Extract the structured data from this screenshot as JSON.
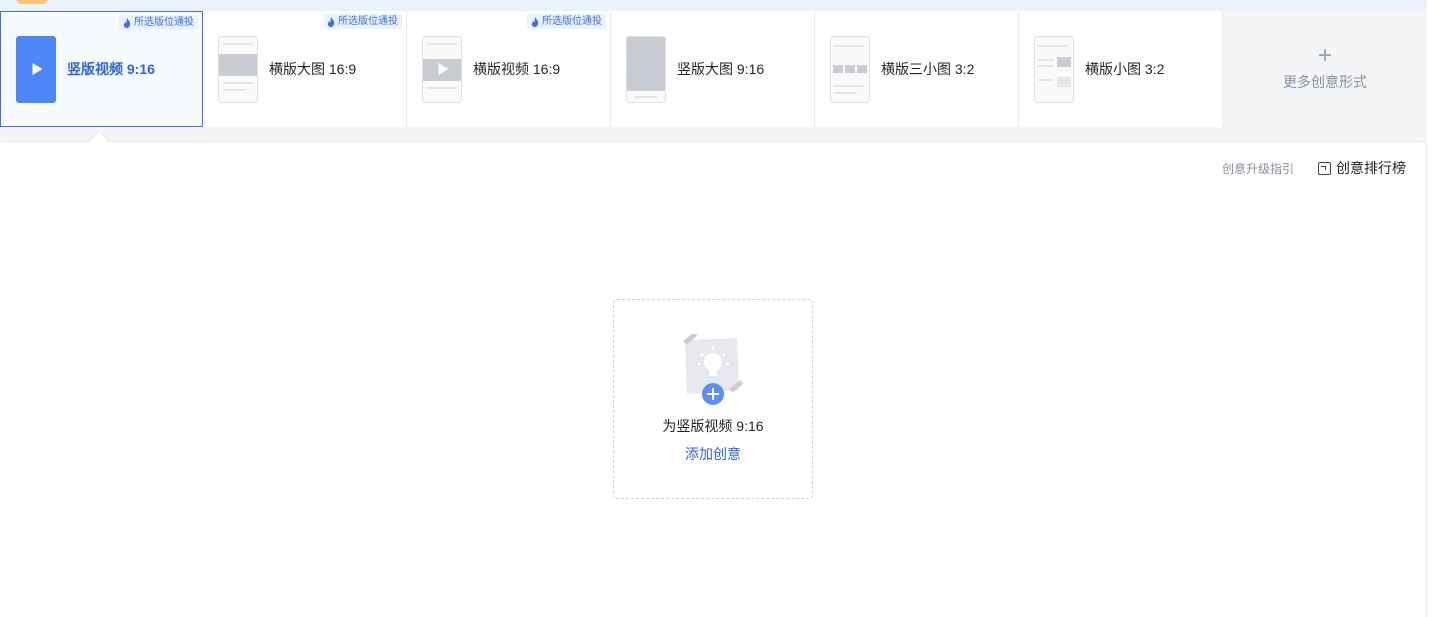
{
  "tabs": [
    {
      "label": "竖版视频 9:16",
      "badge": "所选版位通投",
      "active": true,
      "thumb": "vertical-video"
    },
    {
      "label": "横版大图 16:9",
      "badge": "所选版位通投",
      "active": false,
      "thumb": "horizontal-image"
    },
    {
      "label": "横版视频 16:9",
      "badge": "所选版位通投",
      "active": false,
      "thumb": "horizontal-video"
    },
    {
      "label": "竖版大图 9:16",
      "badge": "",
      "active": false,
      "thumb": "vertical-image"
    },
    {
      "label": "横版三小图 3:2",
      "badge": "",
      "active": false,
      "thumb": "three-small-images"
    },
    {
      "label": "横版小图 3:2",
      "badge": "",
      "active": false,
      "thumb": "small-image"
    }
  ],
  "more": {
    "icon": "plus-icon",
    "label": "更多创意形式"
  },
  "panel": {
    "guide_link": "创意升级指引",
    "rank_link": "创意排行榜",
    "add_card": {
      "title": "为竖版视频 9:16",
      "action": "添加创意"
    }
  },
  "colors": {
    "accent": "#2f64e3",
    "active_border": "#3a70ec",
    "thumb_blue": "#4f86f5"
  }
}
